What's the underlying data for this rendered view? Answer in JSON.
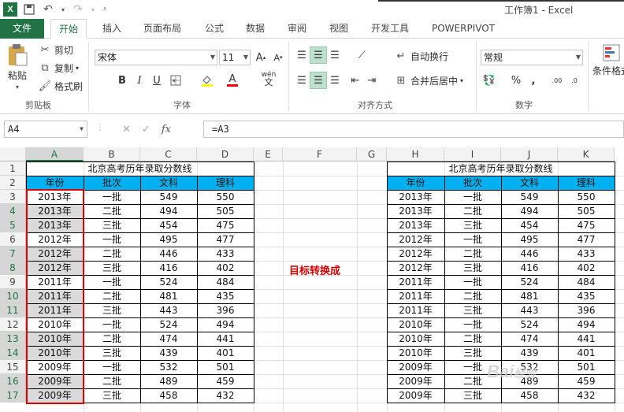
{
  "window": {
    "title": "工作簿1 - Excel"
  },
  "qat": {
    "logo": "X",
    "save_icon": "save-icon",
    "undo_icon": "undo-icon",
    "redo_icon": "redo-icon"
  },
  "tabs": [
    "文件",
    "开始",
    "插入",
    "页面布局",
    "公式",
    "数据",
    "审阅",
    "视图",
    "开发工具",
    "POWERPIVOT"
  ],
  "ribbon": {
    "clipboard": {
      "paste": "粘贴",
      "cut": "剪切",
      "copy": "复制",
      "format_painter": "格式刷",
      "label": "剪贴板"
    },
    "font": {
      "name": "宋体",
      "size": "11",
      "bold": "B",
      "italic": "I",
      "underline": "U",
      "pinyin": "wén",
      "label": "字体"
    },
    "alignment": {
      "wrap": "自动换行",
      "merge": "合并后居中",
      "label": "对齐方式"
    },
    "number": {
      "format": "常规",
      "percent": "%",
      "comma": ",",
      "label": "数字"
    },
    "styles": {
      "conditional": "条件格式"
    }
  },
  "formula_bar": {
    "name_box": "A4",
    "fx": "fx",
    "formula": "=A3"
  },
  "columns": [
    "A",
    "B",
    "C",
    "D",
    "E",
    "F",
    "G",
    "H",
    "I",
    "J",
    "K"
  ],
  "rows": [
    "1",
    "2",
    "3",
    "4",
    "5",
    "6",
    "7",
    "8",
    "9",
    "10",
    "11",
    "12",
    "13",
    "14",
    "15",
    "16",
    "17"
  ],
  "left_table": {
    "title": "北京高考历年录取分数线",
    "headers": [
      "年份",
      "批次",
      "文科",
      "理科"
    ],
    "rows": [
      [
        "2013年",
        "一批",
        "549",
        "550"
      ],
      [
        "2013年",
        "二批",
        "494",
        "505"
      ],
      [
        "2013年",
        "三批",
        "454",
        "475"
      ],
      [
        "2012年",
        "一批",
        "495",
        "477"
      ],
      [
        "2012年",
        "二批",
        "446",
        "433"
      ],
      [
        "2012年",
        "三批",
        "416",
        "402"
      ],
      [
        "2011年",
        "一批",
        "524",
        "484"
      ],
      [
        "2011年",
        "二批",
        "481",
        "435"
      ],
      [
        "2011年",
        "三批",
        "443",
        "396"
      ],
      [
        "2010年",
        "一批",
        "524",
        "494"
      ],
      [
        "2010年",
        "二批",
        "474",
        "441"
      ],
      [
        "2010年",
        "三批",
        "439",
        "401"
      ],
      [
        "2009年",
        "一批",
        "532",
        "501"
      ],
      [
        "2009年",
        "二批",
        "489",
        "459"
      ],
      [
        "2009年",
        "三批",
        "458",
        "432"
      ]
    ]
  },
  "right_table": {
    "title": "北京高考历年录取分数线",
    "headers": [
      "年份",
      "批次",
      "文科",
      "理科"
    ],
    "rows": [
      [
        "2013年",
        "一批",
        "549",
        "550"
      ],
      [
        "2013年",
        "二批",
        "494",
        "505"
      ],
      [
        "2013年",
        "三批",
        "454",
        "475"
      ],
      [
        "2012年",
        "一批",
        "495",
        "477"
      ],
      [
        "2012年",
        "二批",
        "446",
        "433"
      ],
      [
        "2012年",
        "三批",
        "416",
        "402"
      ],
      [
        "2011年",
        "一批",
        "524",
        "484"
      ],
      [
        "2011年",
        "二批",
        "481",
        "435"
      ],
      [
        "2011年",
        "三批",
        "443",
        "396"
      ],
      [
        "2010年",
        "一批",
        "524",
        "494"
      ],
      [
        "2010年",
        "二批",
        "474",
        "441"
      ],
      [
        "2010年",
        "三批",
        "439",
        "401"
      ],
      [
        "2009年",
        "一批",
        "532",
        "501"
      ],
      [
        "2009年",
        "二批",
        "489",
        "459"
      ],
      [
        "2009年",
        "三批",
        "458",
        "432"
      ]
    ]
  },
  "annotation": "目标转换成",
  "watermark": "Bai 经验",
  "colors": {
    "excel_green": "#217346",
    "header_fill": "#00b0f0",
    "highlight_red": "#e00000",
    "annotation_red": "#d40000"
  }
}
